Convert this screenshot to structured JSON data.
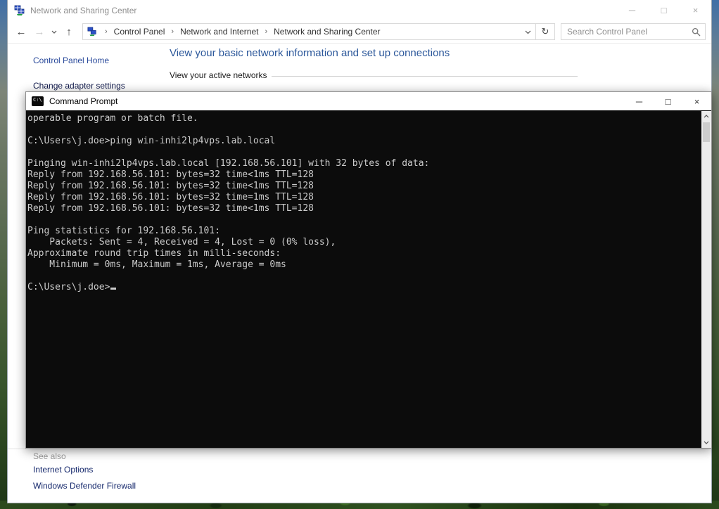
{
  "app_window": {
    "title": "Network and Sharing Center",
    "controls": {
      "minimize": "─",
      "maximize": "□",
      "close": "×"
    }
  },
  "nav": {
    "icons": {
      "back": "←",
      "forward": "→",
      "up": "↑",
      "refresh": "↻",
      "crumb_sep": "›"
    },
    "breadcrumb": [
      "Control Panel",
      "Network and Internet",
      "Network and Sharing Center"
    ],
    "search_placeholder": "Search Control Panel"
  },
  "sidebar": {
    "home_label": "Control Panel Home",
    "task_label": "Change adapter settings"
  },
  "main": {
    "heading": "View your basic network information and set up connections",
    "active_networks_label": "View your active networks"
  },
  "see_also": {
    "header": "See also",
    "links": [
      "Internet Options",
      "Windows Defender Firewall"
    ]
  },
  "cmd": {
    "title": "Command Prompt",
    "icon_label": "C:\\",
    "controls": {
      "minimize": "─",
      "maximize": "□",
      "close": "×"
    },
    "console_text": "operable program or batch file.\n\nC:\\Users\\j.doe>ping win-inhi2lp4vps.lab.local\n\nPinging win-inhi2lp4vps.lab.local [192.168.56.101] with 32 bytes of data:\nReply from 192.168.56.101: bytes=32 time<1ms TTL=128\nReply from 192.168.56.101: bytes=32 time<1ms TTL=128\nReply from 192.168.56.101: bytes=32 time=1ms TTL=128\nReply from 192.168.56.101: bytes=32 time<1ms TTL=128\n\nPing statistics for 192.168.56.101:\n    Packets: Sent = 4, Received = 4, Lost = 0 (0% loss),\nApproximate round trip times in milli-seconds:\n    Minimum = 0ms, Maximum = 1ms, Average = 0ms\n\nC:\\Users\\j.doe>"
  },
  "colors": {
    "heading_blue": "#2b579a",
    "sidebar_link_blue": "#2a4a9b",
    "task_link_navy": "#131c4e",
    "console_bg": "#0c0c0c",
    "console_fg": "#cccccc"
  }
}
